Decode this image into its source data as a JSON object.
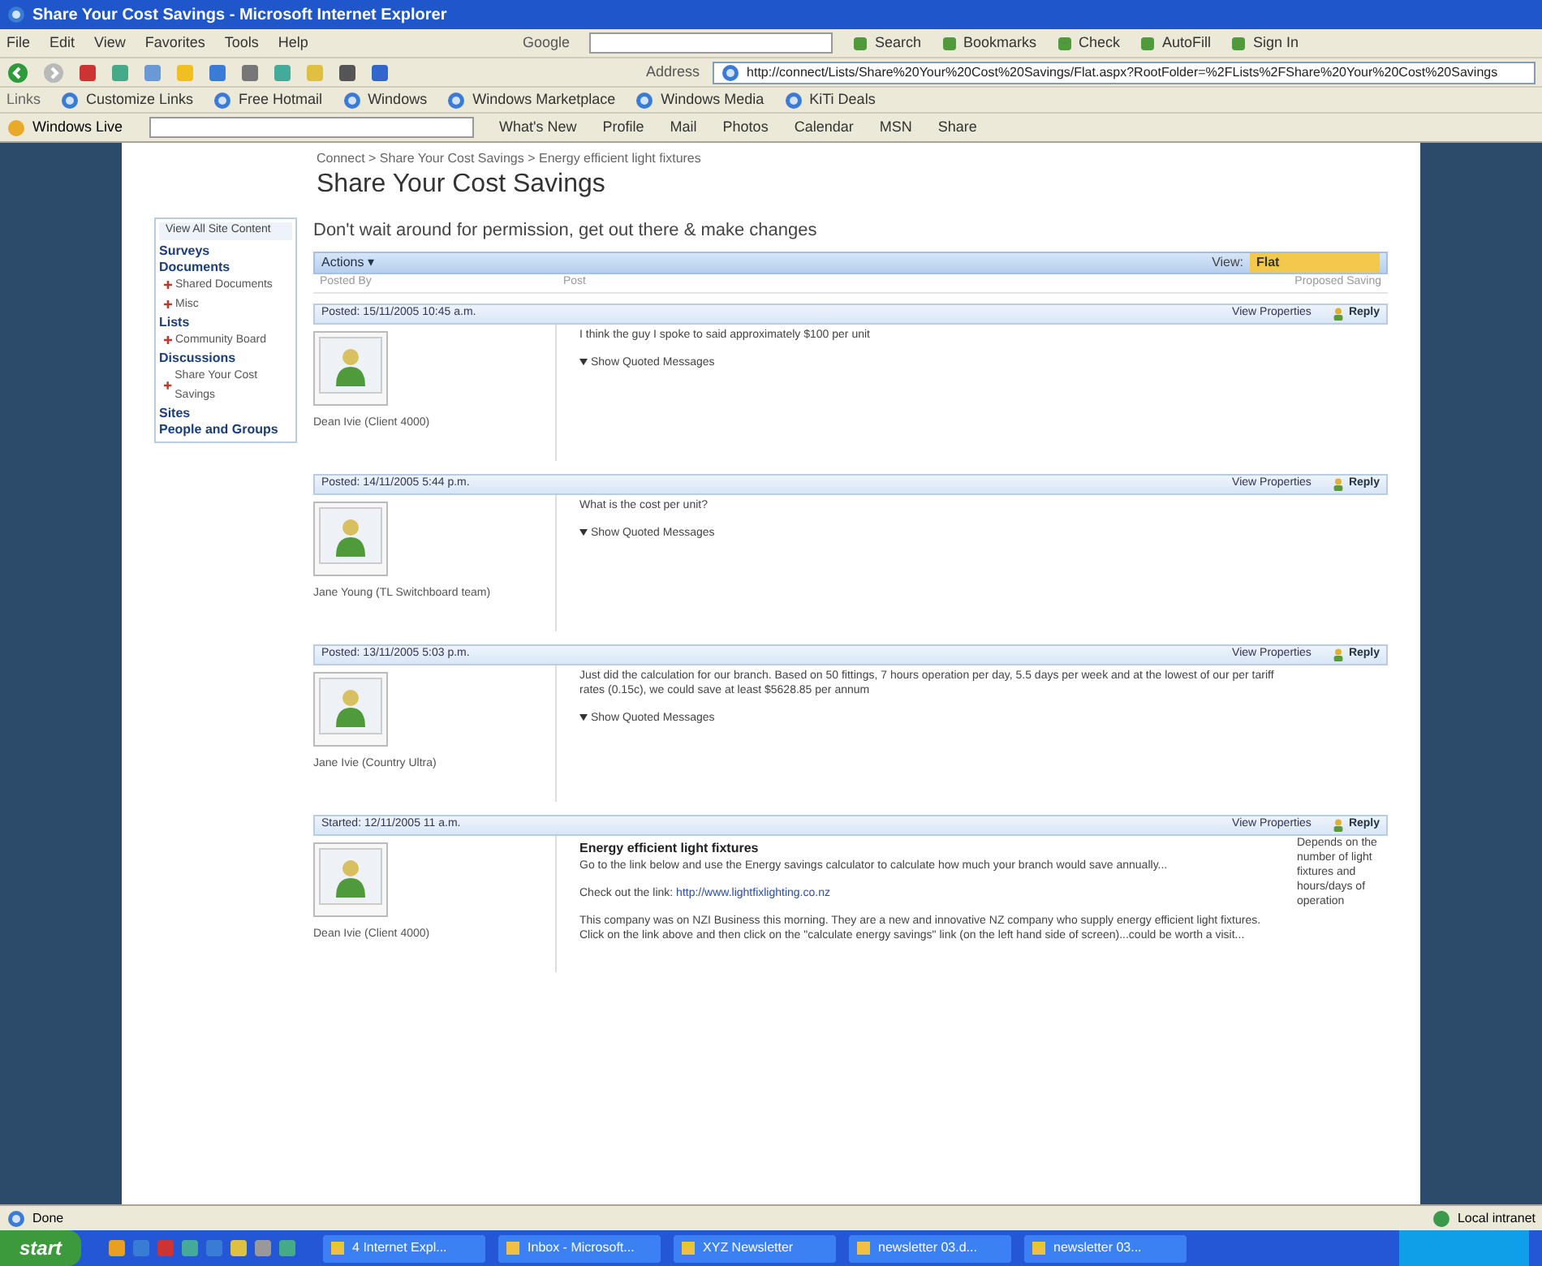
{
  "browser": {
    "title": "Share Your Cost Savings - Microsoft Internet Explorer",
    "menu": [
      "File",
      "Edit",
      "View",
      "Favorites",
      "Tools",
      "Help"
    ],
    "google_label": "Google",
    "google_buttons": [
      "Search",
      "Bookmarks",
      "Check",
      "AutoFill",
      "Sign In"
    ],
    "address_label": "Address",
    "address": "http://connect/Lists/Share%20Your%20Cost%20Savings/Flat.aspx?RootFolder=%2FLists%2FShare%20Your%20Cost%20Savings",
    "links_label": "Links",
    "links": [
      "Customize Links",
      "Free Hotmail",
      "Windows",
      "Windows Marketplace",
      "Windows Media",
      "KiTi Deals"
    ],
    "live_label": "Windows Live",
    "live_items": [
      "What's New",
      "Profile",
      "Mail",
      "Photos",
      "Calendar",
      "MSN",
      "Share"
    ]
  },
  "page": {
    "breadcrumb": "Connect > Share Your Cost Savings > Energy efficient light fixtures",
    "title": "Share Your Cost Savings",
    "nav": [
      {
        "text": "View All Site Content",
        "kind": "top"
      },
      {
        "text": "Surveys",
        "kind": "heading"
      },
      {
        "text": "Documents",
        "kind": "heading"
      },
      {
        "text": "Shared Documents",
        "kind": "item"
      },
      {
        "text": "Misc",
        "kind": "item"
      },
      {
        "text": "Lists",
        "kind": "heading"
      },
      {
        "text": "Community Board",
        "kind": "item"
      },
      {
        "text": "Discussions",
        "kind": "heading"
      },
      {
        "text": "Share Your Cost Savings",
        "kind": "item"
      },
      {
        "text": "Sites",
        "kind": "heading"
      },
      {
        "text": "People and Groups",
        "kind": "heading"
      }
    ],
    "description": "Don't wait around for permission, get out there & make changes",
    "toolbar": {
      "actions": "Actions ▾",
      "view_label": "View:",
      "view_value": "Flat"
    },
    "columns": [
      "Posted By",
      "Post",
      "Proposed Saving"
    ],
    "posts": [
      {
        "posted": "Posted: 15/11/2005 10:45 a.m.",
        "view_properties": "View Properties",
        "reply": "Reply",
        "author": "Dean Ivie (Client 4000)",
        "paragraphs": [
          {
            "text": "I think the guy I spoke to said approximately $100 per unit"
          }
        ],
        "show_quoted": "Show Quoted Messages"
      },
      {
        "posted": "Posted: 14/11/2005 5:44 p.m.",
        "view_properties": "View Properties",
        "reply": "Reply",
        "author": "Jane Young (TL Switchboard team)",
        "paragraphs": [
          {
            "text": "What is the cost per unit?"
          }
        ],
        "show_quoted": "Show Quoted Messages"
      },
      {
        "posted": "Posted: 13/11/2005 5:03 p.m.",
        "view_properties": "View Properties",
        "reply": "Reply",
        "author": "Jane Ivie (Country Ultra)",
        "paragraphs": [
          {
            "text": "Just did the calculation for our branch. Based on 50 fittings, 7 hours operation per day, 5.5 days per week and at the lowest of our per tariff rates (0.15c), we could save at least $5628.85 per annum"
          }
        ],
        "show_quoted": "Show Quoted Messages"
      },
      {
        "posted": "Started: 12/11/2005 11 a.m.",
        "view_properties": "View Properties",
        "reply": "Reply",
        "author": "Dean Ivie (Client 4000)",
        "subject": "Energy efficient light fixtures",
        "paragraphs": [
          {
            "text": "Go to the link below and use the Energy savings calculator to calculate how much your branch would save annually..."
          },
          {
            "text": "Check out the link:",
            "link": "http://www.lightfixlighting.co.nz"
          },
          {
            "text": "This company was on NZI Business this morning. They are a new and innovative NZ company who supply energy efficient light fixtures. Click on the link above and then click on the \"calculate energy savings\" link (on the left hand side of screen)...could be worth a visit..."
          }
        ],
        "saving": "Depends on the number of light fixtures and hours/days of operation"
      }
    ]
  },
  "status": {
    "left": "Done",
    "right": "Local intranet"
  },
  "taskbar": {
    "start": "start",
    "items": [
      "4 Internet Expl...",
      "Inbox - Microsoft...",
      "XYZ Newsletter",
      "newsletter 03.d...",
      "newsletter 03..."
    ]
  }
}
